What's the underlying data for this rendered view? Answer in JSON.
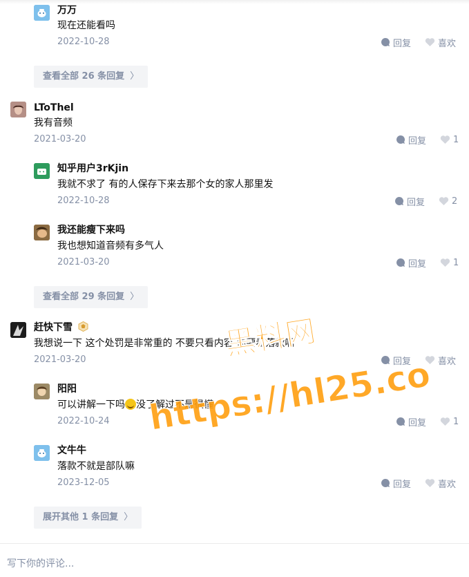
{
  "comments": [
    {
      "name": "万万",
      "content": "现在还能看吗",
      "date": "2022-10-28",
      "reply": "回复",
      "like": "喜欢"
    },
    {
      "more": "查看全部 26 条回复"
    },
    {
      "name": "LToThel",
      "content": "我有音频",
      "date": "2021-03-20",
      "reply": "回复",
      "like": "1"
    },
    {
      "name": "知乎用户3rKjin",
      "content": "我就不求了 有的人保存下来去那个女的家人那里发",
      "date": "2022-10-28",
      "reply": "回复",
      "like": "2"
    },
    {
      "name": "我还能瘦下来吗",
      "content": "我也想知道音频有多气人",
      "date": "2021-03-20",
      "reply": "回复",
      "like": "1"
    },
    {
      "more": "查看全部 29 条回复"
    },
    {
      "name": "赶快下雪",
      "content": "我想说一下 这个处罚是非常重的 不要只看内容 你要看落款啊",
      "date": "2021-03-20",
      "reply": "回复",
      "like": "喜欢"
    },
    {
      "name": "阳阳",
      "content_a": "可以讲解一下吗",
      "content_b": "没了解过不是很懂",
      "date": "2022-10-24",
      "reply": "回复",
      "like": "1"
    },
    {
      "name": "文牛牛",
      "content": "落款不就是部队嘛",
      "date": "2023-12-05",
      "reply": "回复",
      "like": "喜欢"
    },
    {
      "more": "展开其他 1 条回复"
    }
  ],
  "composer": {
    "placeholder": "写下你的评论..."
  },
  "watermark": {
    "line1": "黑料网",
    "line2": "https://hl25.co"
  },
  "colors": {
    "text": "#121212",
    "meta": "#8590a6",
    "button_bg": "#f3f4f6",
    "watermark": "#ff9f10"
  }
}
